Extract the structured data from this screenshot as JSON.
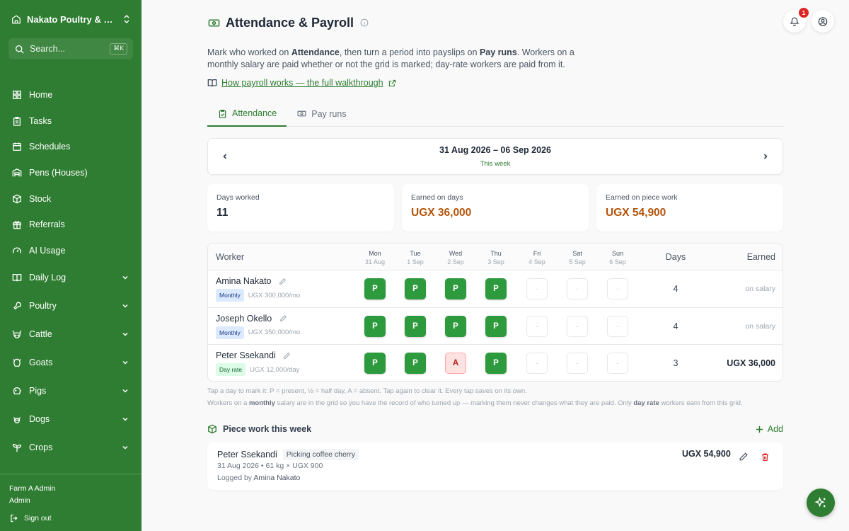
{
  "sidebar": {
    "farm_name": "Nakato Poultry & Da...",
    "search_placeholder": "Search...",
    "search_shortcut": "⌘K",
    "items": [
      {
        "label": "Home",
        "icon": "home-icon"
      },
      {
        "label": "Tasks",
        "icon": "clipboard-icon"
      },
      {
        "label": "Schedules",
        "icon": "calendar-icon"
      },
      {
        "label": "Pens (Houses)",
        "icon": "warehouse-icon"
      },
      {
        "label": "Stock",
        "icon": "box-icon"
      },
      {
        "label": "Referrals",
        "icon": "gift-icon"
      },
      {
        "label": "AI Usage",
        "icon": "gauge-icon"
      }
    ],
    "groups": [
      {
        "label": "Daily Log",
        "icon": "book-icon"
      },
      {
        "label": "Poultry",
        "icon": "drumstick-icon"
      },
      {
        "label": "Cattle",
        "icon": "cattle-icon"
      },
      {
        "label": "Goats",
        "icon": "goat-icon"
      },
      {
        "label": "Pigs",
        "icon": "pig-icon"
      },
      {
        "label": "Dogs",
        "icon": "paw-icon"
      },
      {
        "label": "Crops",
        "icon": "sprout-icon"
      }
    ],
    "user_name": "Farm A Admin",
    "user_role": "Admin",
    "sign_out": "Sign out"
  },
  "header": {
    "title": "Attendance & Payroll",
    "notification_count": "1"
  },
  "intro": {
    "p1": "Mark who worked on ",
    "b1": "Attendance",
    "p2": ", then turn a period into payslips on ",
    "b2": "Pay runs",
    "p3": ". Workers on a monthly salary are paid whether or not the grid is marked; day-rate workers are paid from it."
  },
  "guide_link": "How payroll works — the full walkthrough",
  "tabs": [
    {
      "label": "Attendance",
      "active": true
    },
    {
      "label": "Pay runs",
      "active": false
    }
  ],
  "week": {
    "range": "31 Aug 2026 – 06 Sep 2026",
    "sub": "This week"
  },
  "stats": [
    {
      "label": "Days worked",
      "value": "11"
    },
    {
      "label": "Earned on days",
      "value": "UGX 36,000"
    },
    {
      "label": "Earned on piece work",
      "value": "UGX 54,900"
    }
  ],
  "grid": {
    "col_worker": "Worker",
    "col_days": "Days",
    "col_earned": "Earned",
    "days": [
      {
        "day": "Mon",
        "date": "31 Aug"
      },
      {
        "day": "Tue",
        "date": "1 Sep"
      },
      {
        "day": "Wed",
        "date": "2 Sep"
      },
      {
        "day": "Thu",
        "date": "3 Sep"
      },
      {
        "day": "Fri",
        "date": "4 Sep"
      },
      {
        "day": "Sat",
        "date": "5 Sep"
      },
      {
        "day": "Sun",
        "date": "6 Sep"
      }
    ],
    "workers": [
      {
        "name": "Amina Nakato",
        "type": "Monthly",
        "rate": "UGX 300,000/mo",
        "marks": [
          "P",
          "P",
          "P",
          "P",
          "-",
          "-",
          "-"
        ],
        "days": "4",
        "earned": "on salary"
      },
      {
        "name": "Joseph Okello",
        "type": "Monthly",
        "rate": "UGX 350,000/mo",
        "marks": [
          "P",
          "P",
          "P",
          "P",
          "-",
          "-",
          "-"
        ],
        "days": "4",
        "earned": "on salary"
      },
      {
        "name": "Peter Ssekandi",
        "type": "Day rate",
        "rate": "UGX 12,000/day",
        "marks": [
          "P",
          "P",
          "A",
          "P",
          "-",
          "-",
          "-"
        ],
        "days": "3",
        "earned": "UGX 36,000"
      }
    ]
  },
  "hint1": "Tap a day to mark it: P = present, ½ = half day, A = absent. Tap again to clear it. Every tap saves on its own.",
  "hint2": {
    "a": "Workers on a ",
    "b": "monthly",
    "c": " salary are in the grid so you have the record of who turned up — marking them never changes what they are paid. Only ",
    "d": "day rate",
    "e": " workers earn from this grid."
  },
  "piece_work": {
    "title": "Piece work this week",
    "add_label": "Add",
    "entry": {
      "worker": "Peter Ssekandi",
      "task": "Picking coffee cherry",
      "detail": "31 Aug 2026 • 61 kg × UGX 900",
      "logged_prefix": "Logged by ",
      "logged_by": "Amina Nakato",
      "amount": "UGX 54,900"
    }
  },
  "colors": {
    "brand": "#2f7d32",
    "present": "#2e9a3e",
    "absent_bg": "#fde2e2",
    "money": "#b45309"
  }
}
